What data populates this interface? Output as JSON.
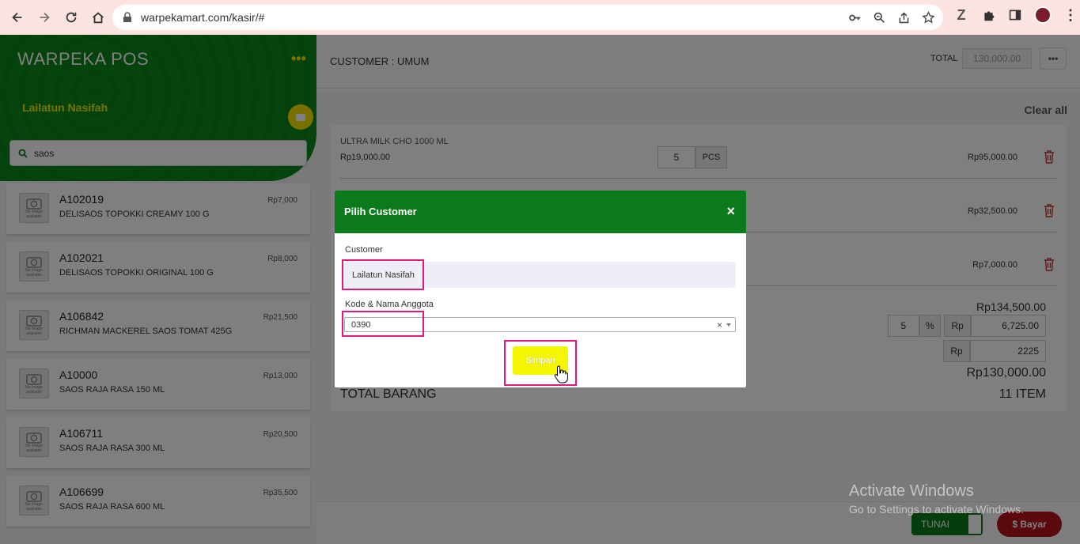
{
  "browser": {
    "url": "warpekamart.com/kasir/#"
  },
  "sidebar": {
    "app_title": "WARPEKA POS",
    "menu_icon": "ellipsis-icon",
    "user_name": "Lailatun Nasifah",
    "search_value": "saos",
    "products": [
      {
        "code": "A102019",
        "name": "DELISAOS TOPOKKI CREAMY 100 G",
        "price": "Rp7,000"
      },
      {
        "code": "A102021",
        "name": "DELISAOS TOPOKKI ORIGINAL 100 G",
        "price": "Rp8,000"
      },
      {
        "code": "A106842",
        "name": "RICHMAN MACKEREL SAOS TOMAT 425G",
        "price": "Rp21,500"
      },
      {
        "code": "A10000",
        "name": "SAOS RAJA RASA 150 ML",
        "price": "Rp13,000"
      },
      {
        "code": "A106711",
        "name": "SAOS RAJA RASA 300 ML",
        "price": "Rp20,500"
      },
      {
        "code": "A106699",
        "name": "SAOS RAJA RASA 600 ML",
        "price": "Rp35,500"
      }
    ],
    "no_image_text": "No Image available"
  },
  "header": {
    "customer_label": "CUSTOMER : UMUM",
    "total_label": "TOTAL",
    "total_value": "130,000.00",
    "more_label": "•••"
  },
  "cart": {
    "clear_all": "Clear all",
    "items": [
      {
        "name": "ULTRA MILK CHO 1000 ML",
        "price": "Rp19,000.00",
        "qty": "5",
        "unit": "PCS",
        "subtotal": "Rp95,000.00"
      },
      {
        "name": "",
        "price": "",
        "qty": "",
        "unit": "",
        "subtotal": "Rp32,500.00"
      },
      {
        "name": "",
        "price": "",
        "qty": "",
        "unit": "",
        "subtotal": "Rp7,000.00"
      }
    ],
    "subtotal": "Rp134,500.00",
    "discount_pct": "5",
    "pct_sign": "%",
    "rp_label": "Rp",
    "discount_amount": "6,725.00",
    "rounding": "2225",
    "grand_total": "Rp130,000.00",
    "total_items_label": "TOTAL BARANG",
    "total_items_value": "11 ITEM"
  },
  "footer": {
    "payment_type": "TUNAI",
    "pay_button": "$ Bayar"
  },
  "watermark": {
    "line1": "Activate Windows",
    "line2": "Go to Settings to activate Windows."
  },
  "modal": {
    "title": "Pilih Customer",
    "close": "×",
    "customer_label": "Customer",
    "customer_value": "Lailatun Nasifah",
    "kode_label": "Kode & Nama Anggota",
    "kode_value": "0390",
    "clear_x": "×",
    "save_button": "Simpan"
  },
  "colors": {
    "brand_green": "#0a8a1a",
    "accent_yellow": "#f5f500",
    "highlight_pink": "#e5177a",
    "pay_red": "#b8131b"
  }
}
